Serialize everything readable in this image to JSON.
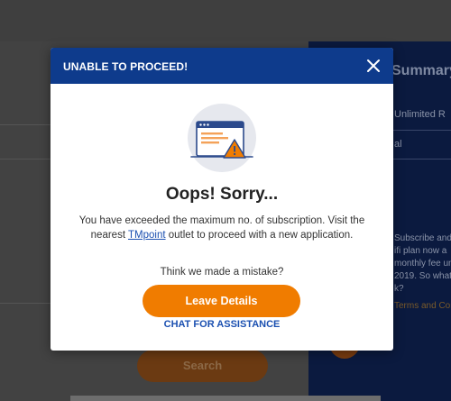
{
  "background": {
    "summary_title": "Summary",
    "summary_line1": "Unlimited R",
    "summary_line2": "al",
    "summary_paragraph": [
      "Subscribe and s",
      "ifi plan now a",
      "monthly fee unt",
      "2019. So what a",
      "k?"
    ],
    "summary_link": "Terms and Con",
    "search_button": "Search"
  },
  "modal": {
    "title": "UNABLE TO PROCEED!",
    "heading": "Oops! Sorry...",
    "message_part1": "You have exceeded the maximum no. of subscription. Visit the nearest ",
    "message_link": "TMpoint",
    "message_part2": " outlet to proceed with a new application.",
    "mistake_prompt": "Think we made a mistake?",
    "leave_details_button": "Leave Details",
    "chat_link": "CHAT FOR ASSISTANCE",
    "icons": {
      "close": "close-icon",
      "illustration": "browser-warning-icon"
    }
  },
  "colors": {
    "header_blue": "#0e3b8c",
    "accent_orange": "#f07c00",
    "link_blue": "#1a4fb0"
  }
}
